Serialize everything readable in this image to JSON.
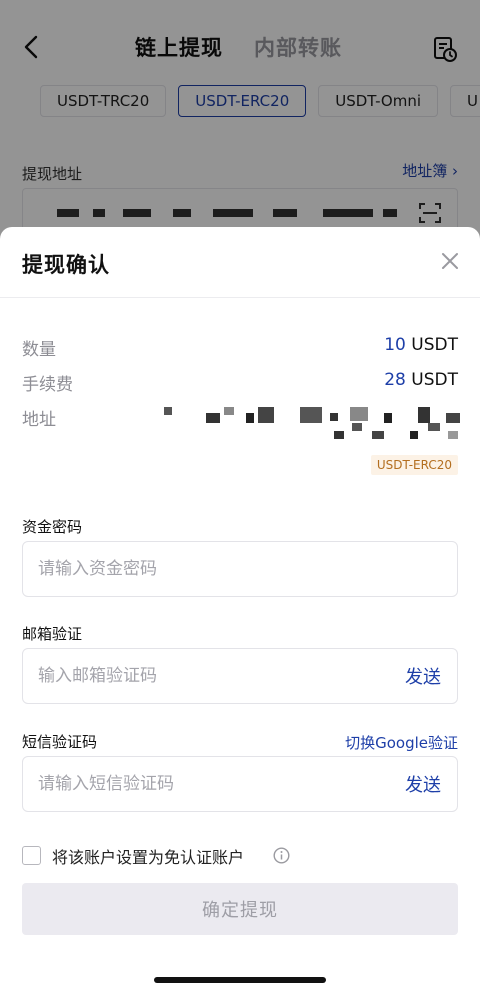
{
  "header": {
    "title": "链上提现",
    "alt_tab": "内部转账"
  },
  "chips": [
    "USDT-TRC20",
    "USDT-ERC20",
    "USDT-Omni",
    "U"
  ],
  "active_chip": "USDT-ERC20",
  "address_section": {
    "label": "提现地址",
    "book_link": "地址簿 ›"
  },
  "sheet": {
    "title": "提现确认",
    "quantity": {
      "label": "数量",
      "amount": "10",
      "unit": " USDT"
    },
    "fee": {
      "label": "手续费",
      "amount": "28",
      "unit": " USDT"
    },
    "address": {
      "label": "地址",
      "chain_tag": "USDT-ERC20"
    },
    "fund_password": {
      "label": "资金密码",
      "placeholder": "请输入资金密码"
    },
    "email_verify": {
      "label": "邮箱验证",
      "placeholder": "输入邮箱验证码",
      "send": "发送"
    },
    "sms_verify": {
      "label": "短信验证码",
      "switch_link": "切换Google验证",
      "placeholder": "请输入短信验证码",
      "send": "发送"
    },
    "exempt_checkbox": {
      "label": "将该账户设置为免认证账户",
      "checked": false
    },
    "confirm_button": "确定提现"
  },
  "colors": {
    "accent": "#1e3fa8",
    "tag_text": "#b36e1f",
    "tag_bg": "#fcf2e6",
    "overlay": "rgba(0,0,0,0.42)"
  },
  "icons": [
    "back-icon",
    "history-icon",
    "scan-icon",
    "chevron-right-icon",
    "close-icon",
    "info-icon"
  ]
}
